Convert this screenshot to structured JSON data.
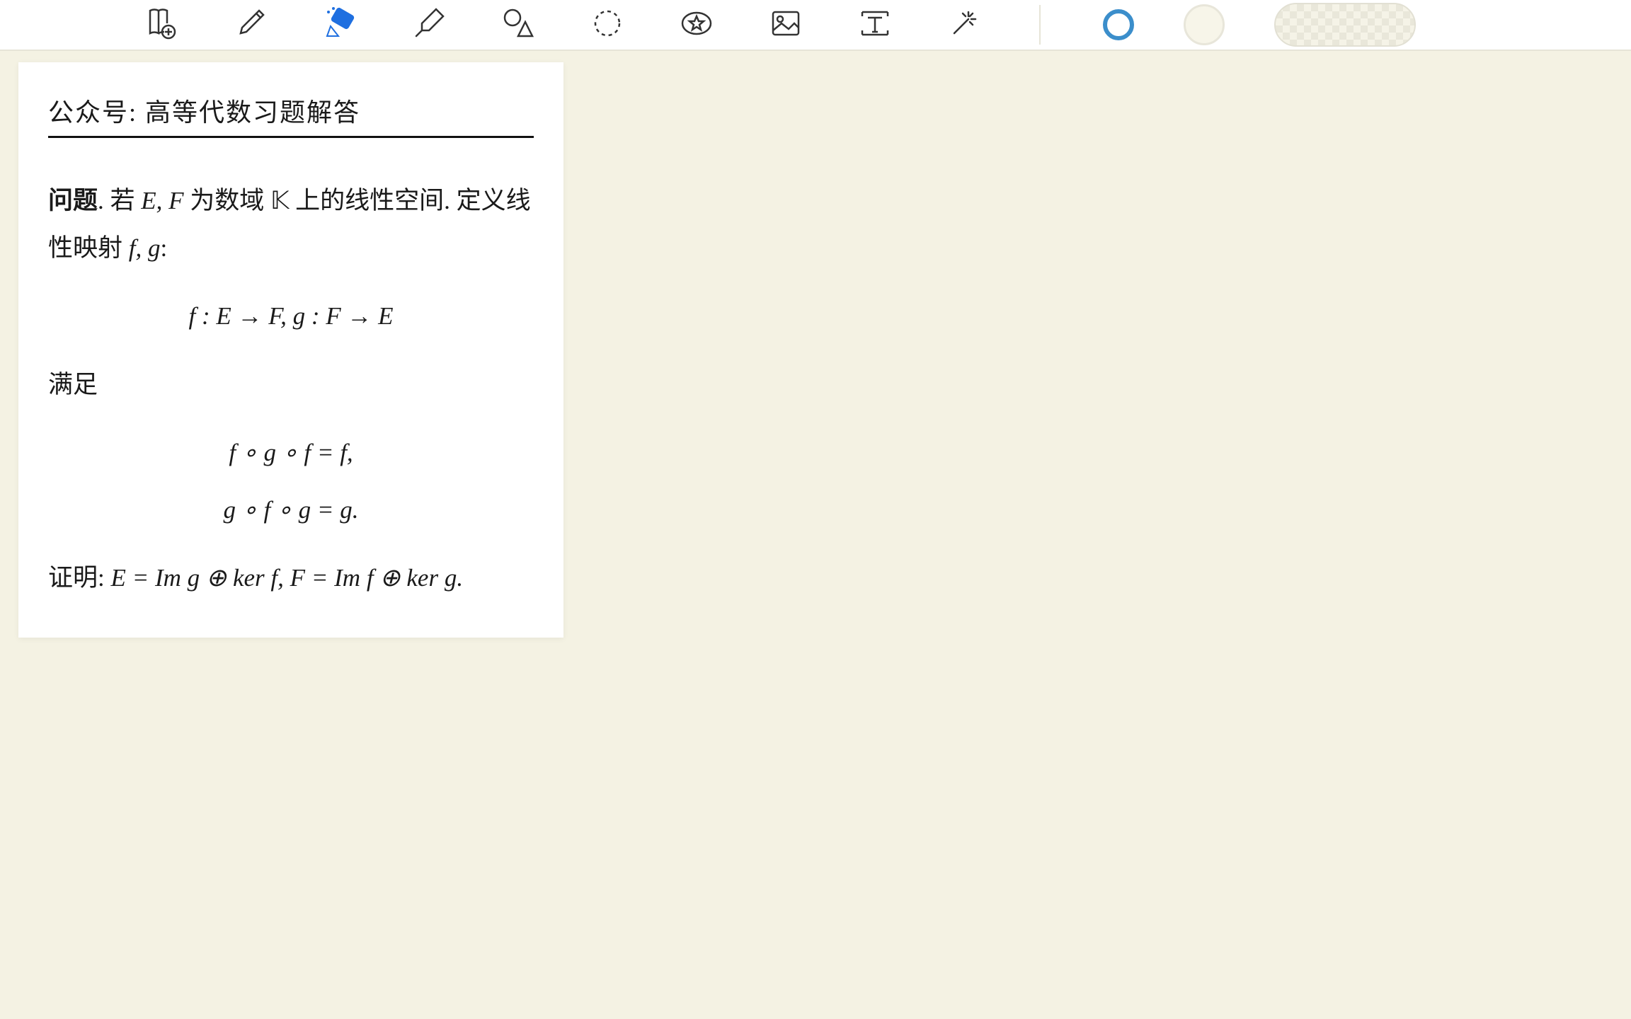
{
  "toolbar": {
    "tools": {
      "add_page": "Add page",
      "pen": "Pen",
      "eraser": "Eraser",
      "highlighter": "Highlighter",
      "shapes": "Shapes",
      "lasso": "Lasso",
      "favorites": "Favorites",
      "image": "Insert image",
      "text": "Text box",
      "pointer": "Laser pointer"
    },
    "active_tool": "eraser",
    "active_color": "#3b8ecb",
    "swatches": [
      "current",
      "none",
      "checker"
    ]
  },
  "card": {
    "source_label": "公众号: 高等代数习题解答",
    "problem_prefix": "问题",
    "sentence_intro": ". 若 ",
    "intro_var_EF": "E, F",
    "intro_mid": " 为数域 ",
    "intro_field": "𝕂",
    "intro_tail": " 上的线性空间.  定义线性映射 ",
    "intro_maps": "f, g",
    "intro_colon": ":",
    "map_display": "f : E → F,  g : F → E",
    "satisfies_label": "满足",
    "eq1": "f ∘ g ∘ f = f,",
    "eq2": "g ∘ f ∘ g = g.",
    "prove_prefix": "证明:",
    "prove_body_E": " E = Im g ⊕ ker f, ",
    "prove_body_F": "F = Im f ⊕ ker g."
  }
}
